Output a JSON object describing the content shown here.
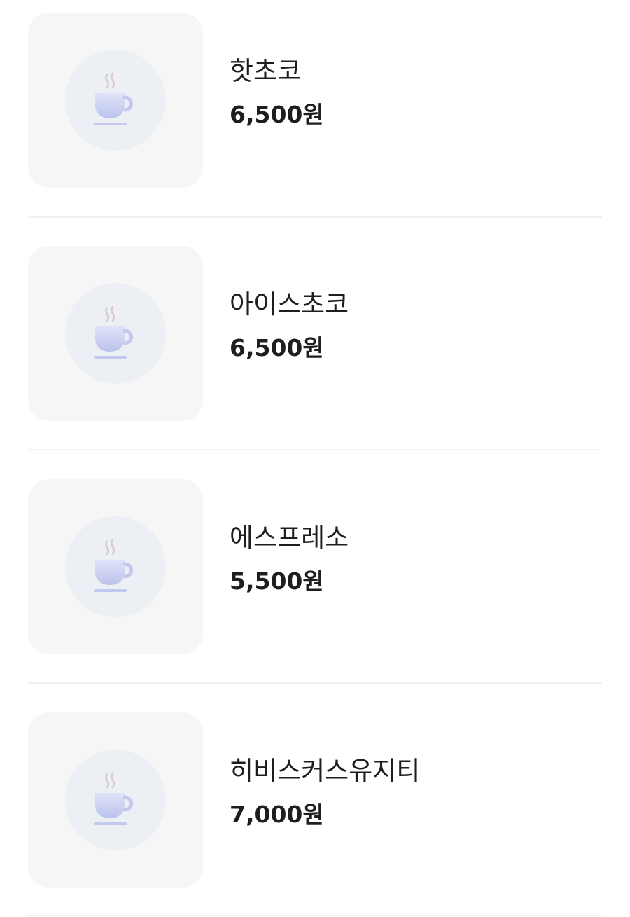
{
  "menu": {
    "items": [
      {
        "name": "핫초코",
        "price": "6,500원",
        "icon": "coffee-cup-icon"
      },
      {
        "name": "아이스초코",
        "price": "6,500원",
        "icon": "coffee-cup-icon"
      },
      {
        "name": "에스프레소",
        "price": "5,500원",
        "icon": "coffee-cup-icon"
      },
      {
        "name": "히비스커스유지티",
        "price": "7,000원",
        "icon": "coffee-cup-icon"
      }
    ]
  },
  "colors": {
    "thumb_background": "#f6f6f7",
    "icon_circle": "#eceff4",
    "cup": "#c7cdef",
    "steam": "#d9c9cc",
    "divider": "#f2f2f3",
    "text": "#1e1e1e"
  }
}
